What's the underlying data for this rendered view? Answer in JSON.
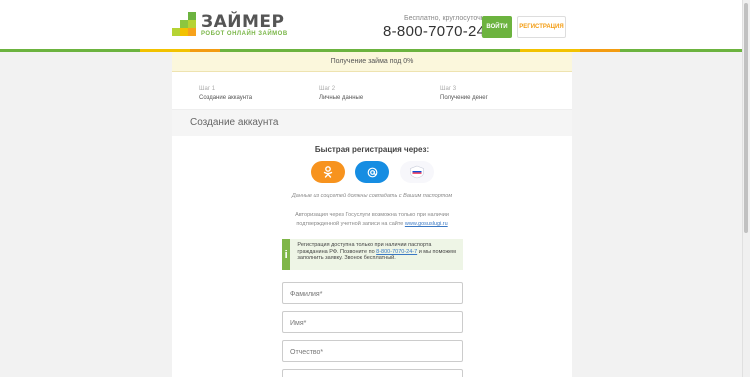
{
  "header": {
    "logo_title": "ЗАЙМЕР",
    "logo_subtitle": "РОБОТ ОНЛАЙН ЗАЙМОВ",
    "free_call_label": "Бесплатно, круглосуточно",
    "phone": "8-800-7070-24-7",
    "login_label": "ВОЙТИ",
    "register_label": "РЕГИСТРАЦИЯ",
    "colors": {
      "green": "#6cb33f",
      "orange": "#f39c12",
      "yellow": "#f2c200"
    }
  },
  "banner": {
    "text": "Получение займа под 0%"
  },
  "steps": [
    {
      "num": "Шаг 1",
      "name": "Создание аккаунта"
    },
    {
      "num": "Шаг 2",
      "name": "Личные данные"
    },
    {
      "num": "Шаг 3",
      "name": "Получение денег"
    }
  ],
  "section": {
    "title": "Создание аккаунта"
  },
  "social": {
    "title": "Быстрая регистрация через:",
    "icons": [
      "odnoklassniki-icon",
      "mailru-icon",
      "gosuslugi-icon"
    ],
    "note": "Данные из соцсетей должны совпадать с Вашим паспортом",
    "gos_note_pre": "Авторизация через Госуслуги возможна только при наличии подтвержденной учетной записи на сайте",
    "gos_link": "www.gosuslugi.ru"
  },
  "info": {
    "icon": "i",
    "text_pre": "Регистрация доступна только при наличии паспорта гражданина РФ. Позвоните по",
    "phone_link": "8-800-7070-24-7",
    "text_post": "и мы поможем заполнить заявку. Звонок бесплатный."
  },
  "form": {
    "lastname_placeholder": "Фамилия*",
    "firstname_placeholder": "Имя*",
    "middlename_placeholder": "Отчество*"
  }
}
